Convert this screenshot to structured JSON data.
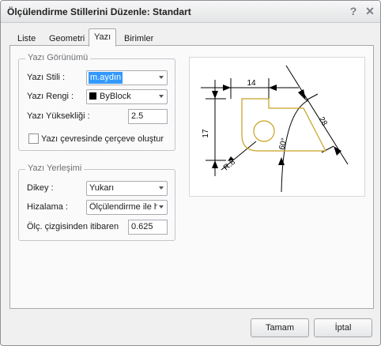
{
  "window": {
    "title": "Ölçülendirme Stillerini Düzenle: Standart"
  },
  "titlebar": {
    "help_glyph": "?",
    "close_glyph": "✕"
  },
  "tabs": [
    {
      "label": "Liste"
    },
    {
      "label": "Geometri"
    },
    {
      "label": "Yazı"
    },
    {
      "label": "Birimler"
    }
  ],
  "active_tab": "Yazı",
  "appearance": {
    "title": "Yazı Görünümü",
    "style": {
      "label": "Yazı Stili :",
      "value": "m.aydın"
    },
    "color": {
      "label": "Yazı Rengi :",
      "value": "ByBlock"
    },
    "height": {
      "label": "Yazı Yüksekliği :",
      "value": "2.5"
    },
    "frame_checkbox": {
      "label": "Yazı çevresinde çerçeve oluştur",
      "checked": false
    }
  },
  "placement": {
    "title": "Yazı Yerleşimi",
    "vertical": {
      "label": "Dikey :",
      "value": "Yukarı"
    },
    "alignment": {
      "label": "Hizalama :",
      "value": "Ölçülendirme ile h"
    },
    "offset": {
      "label": "Ölç. çizgisinden itibaren",
      "value": "0.625"
    }
  },
  "preview": {
    "dim_horizontal": "14",
    "dim_vertical": "17",
    "dim_aligned": "28",
    "dim_angle": "60°",
    "dim_radius": "R.8",
    "part_color": "#c8a020"
  },
  "buttons": {
    "ok": "Tamam",
    "cancel": "İptal"
  }
}
